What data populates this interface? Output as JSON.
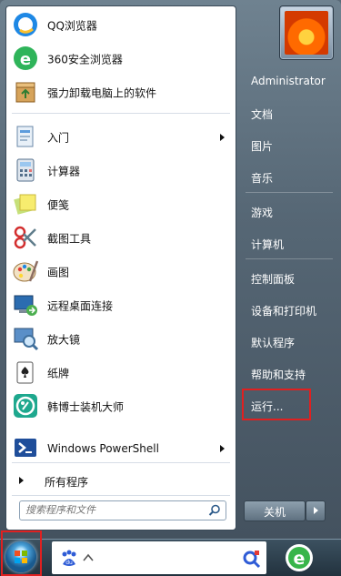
{
  "start_menu": {
    "programs": [
      {
        "label": "QQ浏览器",
        "icon": "qq-browser-icon",
        "submenu": false
      },
      {
        "label": "360安全浏览器",
        "icon": "360-browser-icon",
        "submenu": false
      },
      {
        "label": "强力卸载电脑上的软件",
        "icon": "uninstaller-icon",
        "submenu": false
      },
      {
        "label": "入门",
        "icon": "getting-started-icon",
        "submenu": true
      },
      {
        "label": "计算器",
        "icon": "calculator-icon",
        "submenu": false
      },
      {
        "label": "便笺",
        "icon": "sticky-notes-icon",
        "submenu": false
      },
      {
        "label": "截图工具",
        "icon": "snipping-tool-icon",
        "submenu": false
      },
      {
        "label": "画图",
        "icon": "paint-icon",
        "submenu": false
      },
      {
        "label": "远程桌面连接",
        "icon": "remote-desktop-icon",
        "submenu": false
      },
      {
        "label": "放大镜",
        "icon": "magnifier-icon",
        "submenu": false
      },
      {
        "label": "纸牌",
        "icon": "solitaire-icon",
        "submenu": false
      },
      {
        "label": "韩博士装机大师",
        "icon": "hanboshi-icon",
        "submenu": false
      },
      {
        "label": "Windows PowerShell",
        "icon": "powershell-icon",
        "submenu": true
      }
    ],
    "all_programs": "所有程序",
    "search_placeholder": "搜索程序和文件",
    "right": {
      "user": "Administrator",
      "documents": "文档",
      "pictures": "图片",
      "music": "音乐",
      "games": "游戏",
      "computer": "计算机",
      "control_panel": "控制面板",
      "devices": "设备和打印机",
      "default_programs": "默认程序",
      "help": "帮助和支持",
      "run": "运行..."
    },
    "shutdown": "关机"
  },
  "colors": {
    "highlight": "#e02020",
    "accent": "#1a5a8e"
  }
}
